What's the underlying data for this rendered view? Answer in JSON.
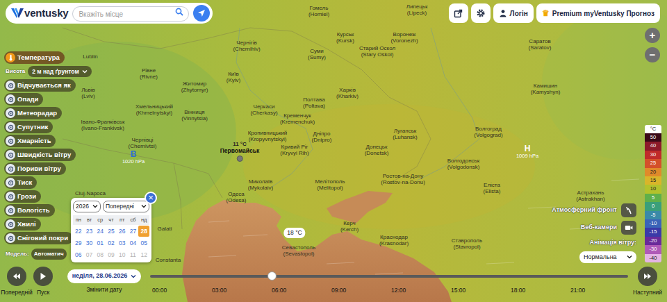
{
  "header": {
    "logo": "ventusky",
    "search": {
      "placeholder": "Вкажіть місце"
    },
    "login": "Логін",
    "premium": {
      "crown": "♛",
      "label": "Premium myVentusky Прогноз"
    }
  },
  "zoom": [
    "+",
    "−"
  ],
  "layers": {
    "items": [
      {
        "label": "Температура",
        "selected": true
      },
      {
        "label": "Відчувається як",
        "selected": false
      },
      {
        "label": "Опади",
        "selected": false
      },
      {
        "label": "Метеорадар",
        "selected": false
      },
      {
        "label": "Супутник",
        "selected": false
      },
      {
        "label": "Хмарність",
        "selected": false
      },
      {
        "label": "Швидкість вітру",
        "selected": false
      },
      {
        "label": "Пориви вітру",
        "selected": false
      },
      {
        "label": "Тиск",
        "selected": false
      },
      {
        "label": "Грози",
        "selected": false
      },
      {
        "label": "Вологість",
        "selected": false
      },
      {
        "label": "Хвилі",
        "selected": false
      },
      {
        "label": "Сніговий покри",
        "selected": false
      }
    ],
    "height": {
      "label": "Висота",
      "value": "2 м над ґрунтом"
    }
  },
  "model": {
    "label": "Модель:",
    "value": "Автоматич"
  },
  "map": {
    "cities": [
      {
        "name": "Гомель",
        "latin": "(Homiel)"
      },
      {
        "name": "Липецьк",
        "latin": "(Lipeck)"
      },
      {
        "name": "Курськ",
        "latin": "(Kursk)"
      },
      {
        "name": "Воронеж",
        "latin": "(Voronezh)"
      },
      {
        "name": "Старий Оскол",
        "latin": "(Stary Oskol)"
      },
      {
        "name": "Саратов",
        "latin": "(Saratov)"
      },
      {
        "name": "Lublin"
      },
      {
        "name": "Чернігів",
        "latin": "(Chernihiv)"
      },
      {
        "name": "Суми",
        "latin": "(Sumy)"
      },
      {
        "name": "Рівне",
        "latin": "(Rivne)"
      },
      {
        "name": "Житомир",
        "latin": "(Zhytomyr)"
      },
      {
        "name": "Київ",
        "latin": "(Kyiv)"
      },
      {
        "name": "Харків",
        "latin": "(Kharkiv)"
      },
      {
        "name": "Камишин",
        "latin": "(Kamyshyn)"
      },
      {
        "name": "Львів",
        "latin": "(Lviv)"
      },
      {
        "name": "Хмельницький",
        "latin": "(Khmelnytskyi)"
      },
      {
        "name": "Вінниця",
        "latin": "(Vinnytsia)"
      },
      {
        "name": "Черкаси",
        "latin": "(Cherkasy)"
      },
      {
        "name": "Полтава",
        "latin": "(Poltava)"
      },
      {
        "name": "Кременчук",
        "latin": "(Kremenchuk)"
      },
      {
        "name": "Івано-Франківськ",
        "latin": "(Ivano-Frankivsk)"
      },
      {
        "name": "Чернівці",
        "latin": "(Chernivtsi)"
      },
      {
        "name": "Кропивницький",
        "latin": "(Kropyvnytskyi)"
      },
      {
        "name": "Дніпро",
        "latin": "(Dnipro)"
      },
      {
        "name": "Луганськ",
        "latin": "(Luhansk)"
      },
      {
        "name": "Волгоград",
        "latin": "(Volgograd)"
      },
      {
        "name": "Донецьк",
        "latin": "(Donetsk)"
      },
      {
        "name": "Кривий Ріг",
        "latin": "(Kryvyi Rih)"
      },
      {
        "name": "Волгодонськ",
        "latin": "(Volgodonsk)"
      },
      {
        "name": "Ростов-на-Дону",
        "latin": "(Rostov-na-Donu)"
      },
      {
        "name": "Миколаїв",
        "latin": "(Mykolaiv)"
      },
      {
        "name": "Мелітополь",
        "latin": "(Melitopol)"
      },
      {
        "name": "Одеса",
        "latin": "(Odesa)"
      },
      {
        "name": "Cluj-Napoca"
      },
      {
        "name": "Еліста",
        "latin": "(Elista)"
      },
      {
        "name": "Астрахань",
        "latin": "(Astrakhan)"
      },
      {
        "name": "Керч",
        "latin": "(Kerch)"
      },
      {
        "name": "Краснодар",
        "latin": "(Krasnodar)"
      },
      {
        "name": "Севастополь",
        "latin": "(Sevastopol)"
      },
      {
        "name": "Ставрополь",
        "latin": "(Stavropol)"
      },
      {
        "name": "Galati"
      },
      {
        "name": "Constanta"
      }
    ],
    "pressure": [
      {
        "letter": "В",
        "value": "1020 hPa",
        "kind": "high"
      },
      {
        "letter": "H",
        "value": "1009 hPa",
        "kind": "low"
      }
    ],
    "point": {
      "temp": "11 °C",
      "place": "Первомайськ"
    },
    "bubble": "18 °C"
  },
  "datepicker": {
    "year": "2026",
    "month": "Попередні",
    "close": "×",
    "weekdays": [
      "пн",
      "вт",
      "ср",
      "чт",
      "пт",
      "сб",
      "нд"
    ],
    "weeks": [
      [
        {
          "day": "22",
          "selected": false,
          "disabled": false
        },
        {
          "day": "23",
          "selected": false,
          "disabled": false
        },
        {
          "day": "24",
          "selected": false,
          "disabled": false
        },
        {
          "day": "25",
          "selected": false,
          "disabled": false
        },
        {
          "day": "26",
          "selected": false,
          "disabled": false
        },
        {
          "day": "27",
          "selected": false,
          "disabled": false
        },
        {
          "day": "28",
          "selected": true,
          "disabled": false
        }
      ],
      [
        {
          "day": "29",
          "selected": false,
          "disabled": false
        },
        {
          "day": "30",
          "selected": false,
          "disabled": false
        },
        {
          "day": "01",
          "selected": false,
          "disabled": false
        },
        {
          "day": "02",
          "selected": false,
          "disabled": false
        },
        {
          "day": "03",
          "selected": false,
          "disabled": false
        },
        {
          "day": "04",
          "selected": false,
          "disabled": false
        },
        {
          "day": "05",
          "selected": false,
          "disabled": false
        }
      ],
      [
        {
          "day": "06",
          "selected": false,
          "disabled": false
        },
        {
          "day": "07",
          "selected": false,
          "disabled": true
        },
        {
          "day": "08",
          "selected": false,
          "disabled": true
        },
        {
          "day": "09",
          "selected": false,
          "disabled": true
        },
        {
          "day": "10",
          "selected": false,
          "disabled": true
        },
        {
          "day": "11",
          "selected": false,
          "disabled": true
        },
        {
          "day": "12",
          "selected": false,
          "disabled": true
        }
      ]
    ]
  },
  "bottom": {
    "prev": "Попередній",
    "play": "Пуск",
    "date": "неділя, 28.06.2026",
    "change": "Змінити дату",
    "next": "Наступний",
    "times": [
      "00:00",
      "03:00",
      "06:00",
      "09:00",
      "12:00",
      "15:00",
      "18:00",
      "21:00"
    ],
    "level": 0.255
  },
  "controls": {
    "front": "Атмосферний фронт",
    "webcams": "Веб-камери",
    "wind_label": "Анімація вітру:",
    "wind_value": "Нормальна"
  },
  "legend": {
    "unit": "°C",
    "items": [
      {
        "value": "50",
        "color": "#3a0a18"
      },
      {
        "value": "40",
        "color": "#8c1a2a"
      },
      {
        "value": "30",
        "color": "#c02a2a"
      },
      {
        "value": "25",
        "color": "#d4502a"
      },
      {
        "value": "20",
        "color": "#e08a2a"
      },
      {
        "value": "15",
        "color": "#d9b52a"
      },
      {
        "value": "10",
        "color": "#b3c22c"
      },
      {
        "value": "5",
        "color": "#5fb04a"
      },
      {
        "value": "0",
        "color": "#3a9f7a"
      },
      {
        "value": "-5",
        "color": "#3a8aa8"
      },
      {
        "value": "-10",
        "color": "#3a64b8"
      },
      {
        "value": "-15",
        "color": "#3a3aa8"
      },
      {
        "value": "-20",
        "color": "#6a2a9a"
      },
      {
        "value": "-30",
        "color": "#b05ab8"
      },
      {
        "value": "-40",
        "color": "#e4b4e4"
      }
    ]
  }
}
